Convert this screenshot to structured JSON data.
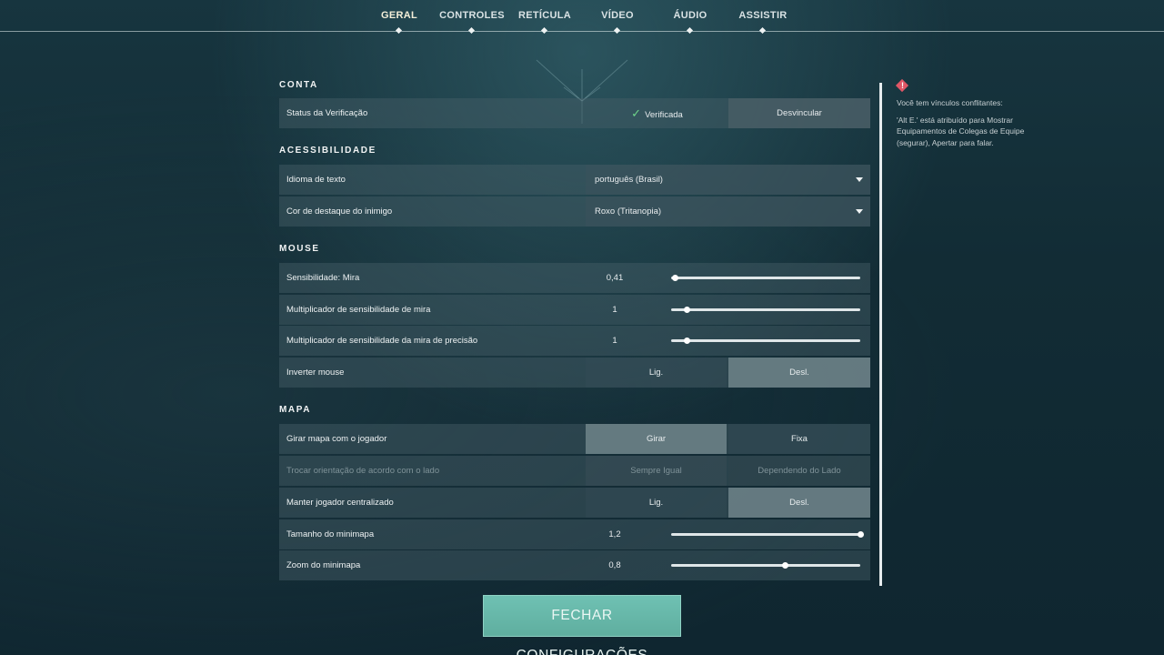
{
  "nav": {
    "tabs": [
      {
        "label": "GERAL"
      },
      {
        "label": "CONTROLES"
      },
      {
        "label": "RETÍCULA"
      },
      {
        "label": "VÍDEO"
      },
      {
        "label": "ÁUDIO"
      },
      {
        "label": "ASSISTIR"
      }
    ],
    "active_tab": "GERAL"
  },
  "sections": {
    "conta": {
      "title": "CONTA",
      "verification_label": "Status da Verificação",
      "verification_status": "Verificada",
      "unlink_button": "Desvincular"
    },
    "acessibilidade": {
      "title": "ACESSIBILIDADE",
      "text_language_label": "Idioma de texto",
      "text_language_value": "português (Brasil)",
      "enemy_color_label": "Cor de destaque do inimigo",
      "enemy_color_value": "Roxo (Tritanopia)"
    },
    "mouse": {
      "title": "MOUSE",
      "sensitivity_label": "Sensibilidade: Mira",
      "sensitivity_value": "0,41",
      "sensitivity_fraction": 0.02,
      "scope_mult_label": "Multiplicador de sensibilidade de mira",
      "scope_mult_value": "1",
      "scope_mult_fraction": 0.08,
      "precision_mult_label": "Multiplicador de sensibilidade da mira de precisão",
      "precision_mult_value": "1",
      "precision_mult_fraction": 0.08,
      "invert_label": "Inverter mouse",
      "on_label": "Lig.",
      "off_label": "Desl.",
      "invert_selected": "Desl."
    },
    "mapa": {
      "title": "MAPA",
      "rotate_label": "Girar mapa com o jogador",
      "rotate_option": "Girar",
      "fixed_option": "Fixa",
      "rotate_selected": "Girar",
      "orientation_label": "Trocar orientação de acordo com o lado",
      "always_same": "Sempre Igual",
      "depends_side": "Dependendo do Lado",
      "keep_centered_label": "Manter jogador centralizado",
      "on_label": "Lig.",
      "off_label": "Desl.",
      "keep_centered_selected": "Desl.",
      "minimap_size_label": "Tamanho do minimapa",
      "minimap_size_value": "1,2",
      "minimap_size_fraction": 1.0,
      "minimap_zoom_label": "Zoom do minimapa",
      "minimap_zoom_value": "0,8",
      "minimap_zoom_fraction": 0.6
    }
  },
  "warning": {
    "line1": "Você tem vínculos conflitantes:",
    "line2": "'Alt E.' está atribuído para Mostrar Equipamentos de Colegas de Equipe (segurar), Apertar para falar."
  },
  "close_button": "FECHAR CONFIGURAÇÕES",
  "colors": {
    "accent_button": "#6fc1b3",
    "verified_check": "#6fd48a",
    "warning_icon": "#e05666"
  }
}
